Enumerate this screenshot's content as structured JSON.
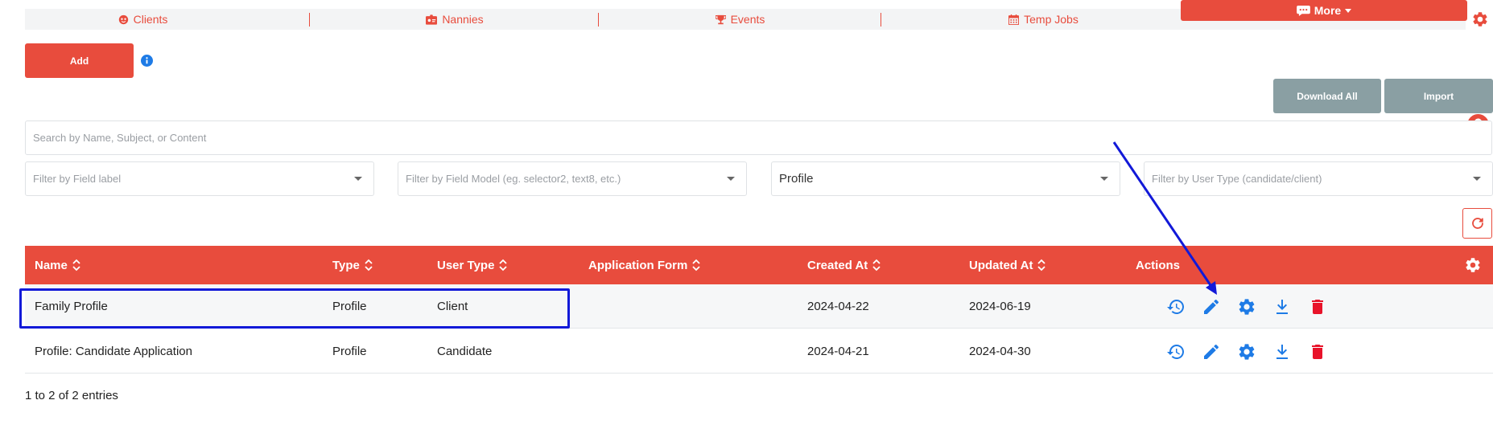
{
  "nav": {
    "items": [
      {
        "label": "Clients",
        "icon": "clients-icon"
      },
      {
        "label": "Nannies",
        "icon": "badge-icon"
      },
      {
        "label": "Events",
        "icon": "trophy-icon"
      },
      {
        "label": "Temp Jobs",
        "icon": "calendar-icon"
      }
    ],
    "more_label": "More",
    "more_icon": "chat-icon",
    "accent": "#e84c3d"
  },
  "toolbar": {
    "add_label": "Add",
    "download_all_label": "Download All",
    "import_label": "Import"
  },
  "search": {
    "placeholder": "Search by Name, Subject, or Content"
  },
  "filters": {
    "field_label_placeholder": "Filter by Field label",
    "field_model_placeholder": "Filter by Field Model (eg. selector2, text8, etc.)",
    "category_value": "Profile",
    "user_type_placeholder": "Filter by User Type (candidate/client)"
  },
  "table": {
    "headers": {
      "name": "Name",
      "type": "Type",
      "user_type": "User Type",
      "application_form": "Application Form",
      "created_at": "Created At",
      "updated_at": "Updated At",
      "actions": "Actions"
    },
    "rows": [
      {
        "name": "Family Profile",
        "type": "Profile",
        "user_type": "Client",
        "application_form": "",
        "created_at": "2024-04-22",
        "updated_at": "2024-06-19"
      },
      {
        "name": "Profile: Candidate Application",
        "type": "Profile",
        "user_type": "Candidate",
        "application_form": "",
        "created_at": "2024-04-21",
        "updated_at": "2024-04-30"
      }
    ],
    "action_icons": [
      "history-icon",
      "edit-icon",
      "settings-icon",
      "download-icon",
      "delete-icon"
    ]
  },
  "footer": {
    "entries_text": "1 to 2 of 2 entries"
  },
  "colors": {
    "primary": "#e84c3d",
    "gray_button": "#8a9fa3",
    "action_blue": "#1e7be6",
    "delete_red": "#e8132a",
    "annotation_blue": "#1219d8"
  }
}
